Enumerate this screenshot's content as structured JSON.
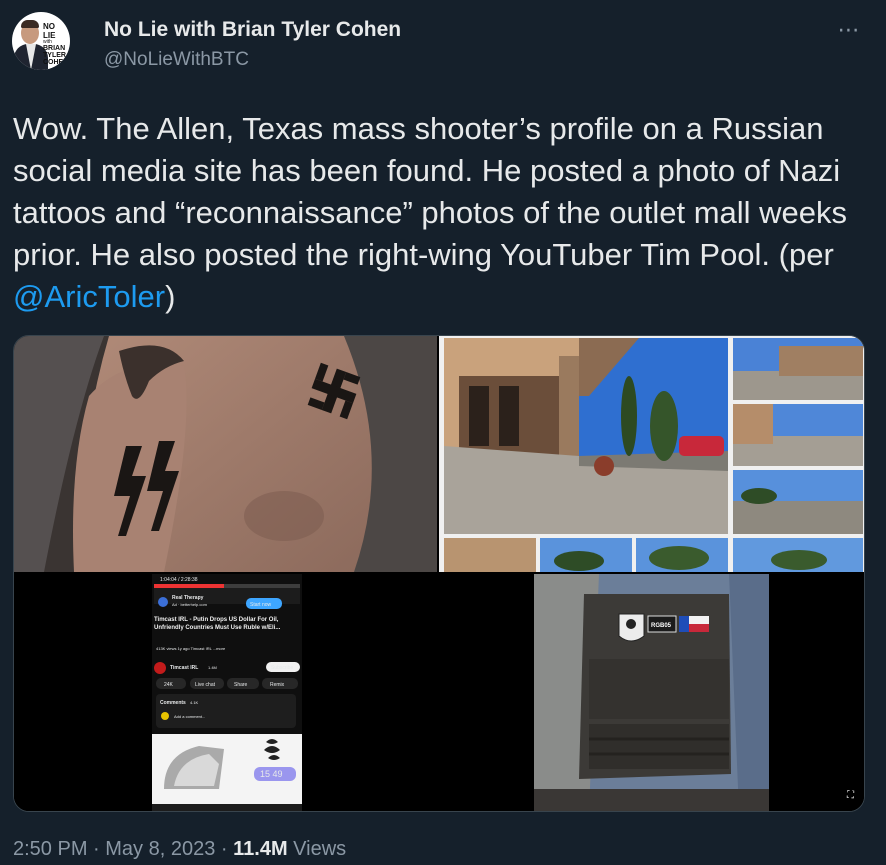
{
  "author": {
    "name": "No Lie with Brian Tyler Cohen",
    "handle": "@NoLieWithBTC",
    "avatar_text": [
      "NO LIE",
      "with",
      "BRIAN",
      "TYLER",
      "COHEN"
    ]
  },
  "more_icon": "⋯",
  "tweet": {
    "text_before": "Wow. The Allen, Texas mass shooter’s profile on a Russian social media site has been found. He posted a photo of Nazi tattoos and “reconnaissance” photos of the outlet mall weeks prior. He also posted the right-wing YouTuber Tim Pool. (per ",
    "mention": "@AricToler",
    "text_after": ")"
  },
  "media": {
    "phone": {
      "time": "1:04:04 / 2:28:38",
      "ad_title": "Real Therapy",
      "ad_sub": "Ad · betterhelp.com",
      "ad_button": "Start now",
      "video_title": "Timcast IRL - Putin Drops US Dollar For Oil, Unfriendly Countries Must Use Ruble w/Eli...",
      "video_meta": "413K views  1y ago  Timcast IRL ...more",
      "channel": "Timcast IRL",
      "channel_subs": "1.4M",
      "subscribe": "Subscribe",
      "likes": "24K",
      "live_chat": "Live chat",
      "share": "Share",
      "remix": "Remix",
      "comments_label": "Comments",
      "comments_count": "4.1K",
      "comment_placeholder": "Add a comment...",
      "clock": "15 49"
    },
    "vest_patch": "RGB05"
  },
  "footer": {
    "time": "2:50 PM",
    "sep": " · ",
    "date": "May 8, 2023",
    "sep2": " · ",
    "views_count": "11.4M",
    "views_label": " Views"
  }
}
